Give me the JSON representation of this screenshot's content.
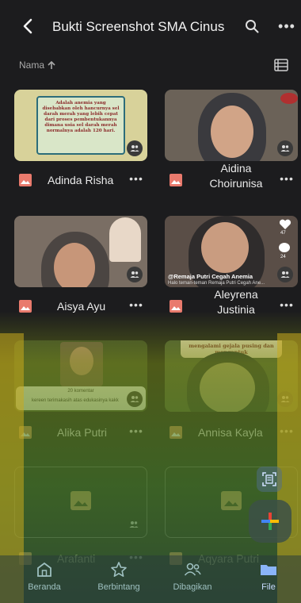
{
  "header": {
    "title": "Bukti Screenshot SMA Cinus",
    "back_label": "back",
    "more_label": "•••"
  },
  "sort": {
    "label": "Nama",
    "direction": "ascending"
  },
  "files": [
    {
      "name": "Adinda Risha",
      "thumb": "document",
      "doc_text": "Adalah anemia yang disebabkan oleh hancurnya sel darah merah yang lebih cepat dari proses pembentukannya dimana usia sel darah merah normalnya adalah 120 hari."
    },
    {
      "name": "Aidina Choirunisa",
      "thumb": "face"
    },
    {
      "name": "Aisya Ayu",
      "thumb": "face"
    },
    {
      "name": "Aleyrena Justinia",
      "thumb": "face",
      "caption1": "@Remaja Putri Cegah Anemia",
      "caption2": "Halo teman-teman Remaja Putri Cegah Ane...",
      "likes": "47",
      "comments": "24"
    },
    {
      "name": "Alika Putri",
      "thumb": "face",
      "comment_header": "20 komentar",
      "comment_text": "kereen terimakasih atas edukasinya kakk"
    },
    {
      "name": "Annisa Kayla",
      "thumb": "face",
      "banner_text": "mengalami gejala pusing dan mengantuk"
    },
    {
      "name": "Arafanti",
      "thumb": "empty"
    },
    {
      "name": "Aqyara Putri",
      "thumb": "empty"
    }
  ],
  "item_more_label": "•••",
  "nav": [
    {
      "label": "Beranda",
      "icon": "home-icon",
      "active": false
    },
    {
      "label": "Berbintang",
      "icon": "star-icon",
      "active": false
    },
    {
      "label": "Dibagikan",
      "icon": "shared-icon",
      "active": false
    },
    {
      "label": "File",
      "icon": "folder-icon",
      "active": true
    }
  ],
  "colors": {
    "accent": "#8ab4f8",
    "file_icon": "#e97a6d",
    "background": "#1c1c1e"
  }
}
